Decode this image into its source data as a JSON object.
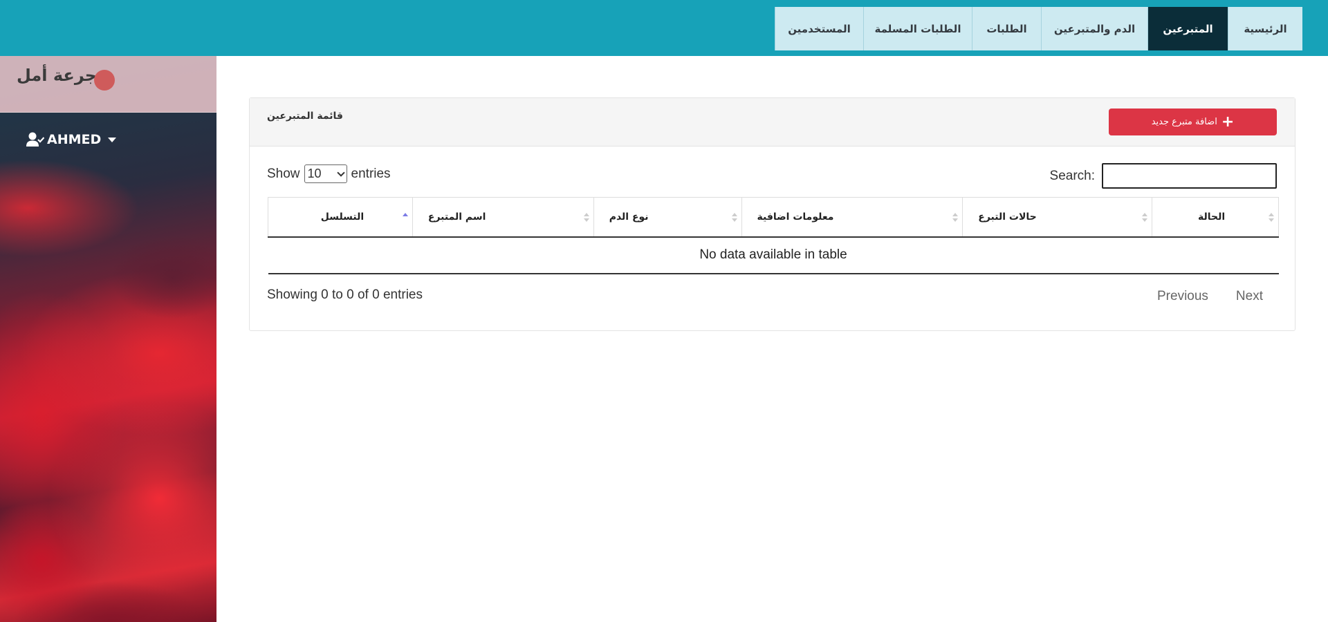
{
  "nav": {
    "items": [
      {
        "label": "الرئيسية",
        "active": false
      },
      {
        "label": "المتبرعين",
        "active": true
      },
      {
        "label": "الدم والمتبرعين",
        "active": false
      },
      {
        "label": "الطلبات",
        "active": false
      },
      {
        "label": "الطلبات المسلمة",
        "active": false
      },
      {
        "label": "المستخدمين",
        "active": false
      }
    ]
  },
  "sidebar": {
    "brand": "جرعة أمل",
    "user": "AHMED",
    "user_icon": "user-check-icon"
  },
  "card": {
    "title": "قائمة المتبرعين",
    "add_button": "اضافة متبرع جديد",
    "add_icon": "plus-icon"
  },
  "table_controls": {
    "show_label": "Show",
    "entries_value": "10",
    "entries_label": "entries",
    "search_label": "Search:",
    "search_value": ""
  },
  "table": {
    "columns": [
      "التسلسل",
      "اسم المتبرع",
      "نوع الدم",
      "معلومات اضافية",
      "حالات التبرع",
      "الحالة"
    ],
    "sorted_column": 0,
    "sort_direction": "asc",
    "empty_message": "No data available in table"
  },
  "footer": {
    "info": "Showing 0 to 0 of 0 entries",
    "previous": "Previous",
    "next": "Next"
  },
  "colors": {
    "topbar": "#17a2b8",
    "nav_active": "#0b2d39",
    "nav_inactive": "#cdeaf1",
    "add_button": "#dc3545",
    "brand_dot": "#cf5b5b"
  }
}
